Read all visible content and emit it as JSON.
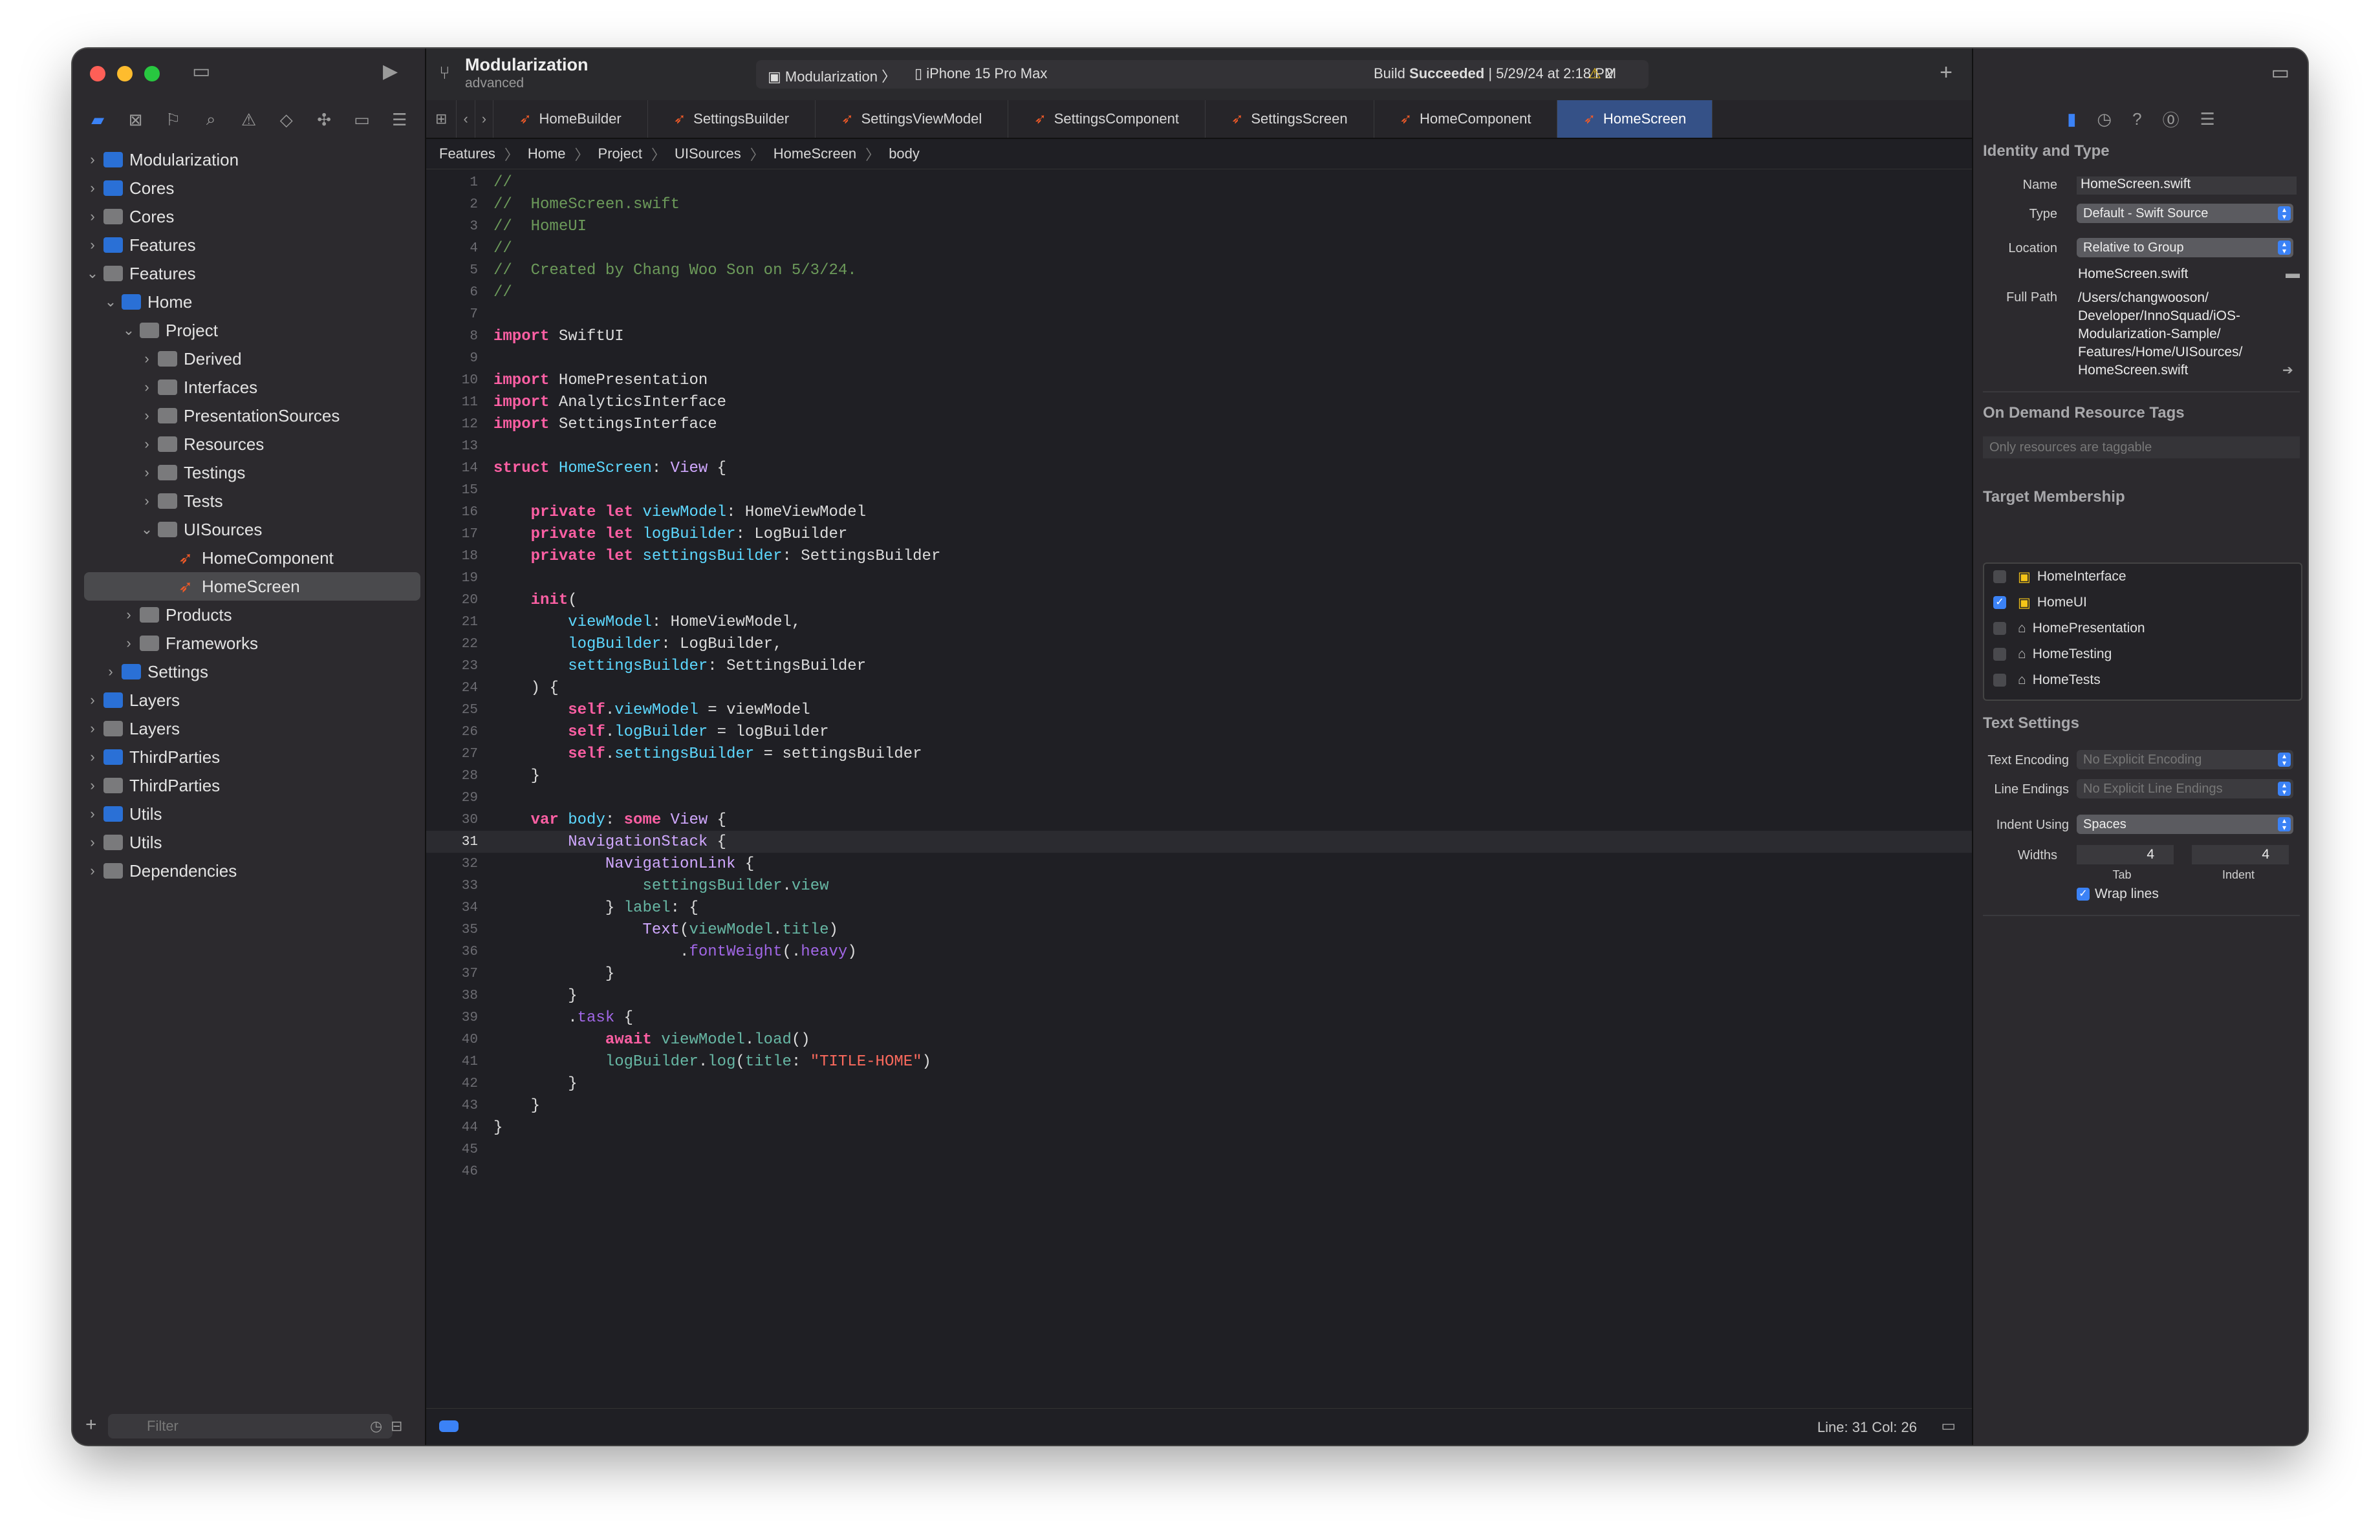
{
  "toolbar": {
    "project": "Modularization",
    "branch": "advanced",
    "scheme": "Modularization",
    "device": "iPhone 15 Pro Max",
    "build_status_prefix": "Build ",
    "build_status_bold": "Succeeded",
    "build_status_suffix": " | 5/29/24 at 2:18 PM",
    "warning_count": "2"
  },
  "navigator": {
    "items": [
      {
        "label": "Modularization",
        "depth": 0,
        "chevron": "›",
        "kind": "proj"
      },
      {
        "label": "Cores",
        "depth": 0,
        "chevron": "›",
        "kind": "proj"
      },
      {
        "label": "Cores",
        "depth": 0,
        "chevron": "›",
        "kind": "fold"
      },
      {
        "label": "Features",
        "depth": 0,
        "chevron": "›",
        "kind": "proj"
      },
      {
        "label": "Features",
        "depth": 0,
        "chevron": "⌄",
        "kind": "fold"
      },
      {
        "label": "Home",
        "depth": 1,
        "chevron": "⌄",
        "kind": "proj"
      },
      {
        "label": "Project",
        "depth": 2,
        "chevron": "⌄",
        "kind": "fold"
      },
      {
        "label": "Derived",
        "depth": 3,
        "chevron": "›",
        "kind": "fold"
      },
      {
        "label": "Interfaces",
        "depth": 3,
        "chevron": "›",
        "kind": "fold"
      },
      {
        "label": "PresentationSources",
        "depth": 3,
        "chevron": "›",
        "kind": "fold"
      },
      {
        "label": "Resources",
        "depth": 3,
        "chevron": "›",
        "kind": "fold"
      },
      {
        "label": "Testings",
        "depth": 3,
        "chevron": "›",
        "kind": "fold"
      },
      {
        "label": "Tests",
        "depth": 3,
        "chevron": "›",
        "kind": "fold"
      },
      {
        "label": "UISources",
        "depth": 3,
        "chevron": "⌄",
        "kind": "fold"
      },
      {
        "label": "HomeComponent",
        "depth": 4,
        "chevron": "",
        "kind": "swift"
      },
      {
        "label": "HomeScreen",
        "depth": 4,
        "chevron": "",
        "kind": "swift",
        "selected": true
      },
      {
        "label": "Products",
        "depth": 2,
        "chevron": "›",
        "kind": "fold"
      },
      {
        "label": "Frameworks",
        "depth": 2,
        "chevron": "›",
        "kind": "fold"
      },
      {
        "label": "Settings",
        "depth": 1,
        "chevron": "›",
        "kind": "proj"
      },
      {
        "label": "Layers",
        "depth": 0,
        "chevron": "›",
        "kind": "proj"
      },
      {
        "label": "Layers",
        "depth": 0,
        "chevron": "›",
        "kind": "fold"
      },
      {
        "label": "ThirdParties",
        "depth": 0,
        "chevron": "›",
        "kind": "proj"
      },
      {
        "label": "ThirdParties",
        "depth": 0,
        "chevron": "›",
        "kind": "fold"
      },
      {
        "label": "Utils",
        "depth": 0,
        "chevron": "›",
        "kind": "proj"
      },
      {
        "label": "Utils",
        "depth": 0,
        "chevron": "›",
        "kind": "fold"
      },
      {
        "label": "Dependencies",
        "depth": 0,
        "chevron": "›",
        "kind": "fold"
      }
    ],
    "filter_placeholder": "Filter"
  },
  "tabs": [
    "HomeBuilder",
    "SettingsBuilder",
    "SettingsViewModel",
    "SettingsComponent",
    "SettingsScreen",
    "HomeComponent",
    "HomeScreen"
  ],
  "active_tab": "HomeScreen",
  "breadcrumb": [
    "Features",
    "Home",
    "Project",
    "UISources",
    "HomeScreen",
    "body"
  ],
  "code_lines": [
    [
      [
        "c",
        "//"
      ]
    ],
    [
      [
        "c",
        "//  HomeScreen.swift"
      ]
    ],
    [
      [
        "c",
        "//  HomeUI"
      ]
    ],
    [
      [
        "c",
        "//"
      ]
    ],
    [
      [
        "c",
        "//  Created by Chang Woo Son on 5/3/24."
      ]
    ],
    [
      [
        "c",
        "//"
      ]
    ],
    [],
    [
      [
        "k",
        "import"
      ],
      [
        "p",
        " SwiftUI"
      ]
    ],
    [],
    [
      [
        "k",
        "import"
      ],
      [
        "p",
        " HomePresentation"
      ]
    ],
    [
      [
        "k",
        "import"
      ],
      [
        "p",
        " AnalyticsInterface"
      ]
    ],
    [
      [
        "k",
        "import"
      ],
      [
        "p",
        " SettingsInterface"
      ]
    ],
    [],
    [
      [
        "k",
        "struct"
      ],
      [
        "p",
        " "
      ],
      [
        "d",
        "HomeScreen"
      ],
      [
        "p",
        ": "
      ],
      [
        "t",
        "View"
      ],
      [
        "p",
        " {"
      ]
    ],
    [],
    [
      [
        "p",
        "    "
      ],
      [
        "k",
        "private let"
      ],
      [
        "p",
        " "
      ],
      [
        "d",
        "viewModel"
      ],
      [
        "p",
        ": HomeViewModel"
      ]
    ],
    [
      [
        "p",
        "    "
      ],
      [
        "k",
        "private let"
      ],
      [
        "p",
        " "
      ],
      [
        "d",
        "logBuilder"
      ],
      [
        "p",
        ": LogBuilder"
      ]
    ],
    [
      [
        "p",
        "    "
      ],
      [
        "k",
        "private let"
      ],
      [
        "p",
        " "
      ],
      [
        "d",
        "settingsBuilder"
      ],
      [
        "p",
        ": SettingsBuilder"
      ]
    ],
    [],
    [
      [
        "p",
        "    "
      ],
      [
        "k",
        "init"
      ],
      [
        "p",
        "("
      ]
    ],
    [
      [
        "p",
        "        "
      ],
      [
        "d",
        "viewModel"
      ],
      [
        "p",
        ": HomeViewModel,"
      ]
    ],
    [
      [
        "p",
        "        "
      ],
      [
        "d",
        "logBuilder"
      ],
      [
        "p",
        ": LogBuilder,"
      ]
    ],
    [
      [
        "p",
        "        "
      ],
      [
        "d",
        "settingsBuilder"
      ],
      [
        "p",
        ": SettingsBuilder"
      ]
    ],
    [
      [
        "p",
        "    ) {"
      ]
    ],
    [
      [
        "p",
        "        "
      ],
      [
        "k",
        "self"
      ],
      [
        "p",
        "."
      ],
      [
        "d",
        "viewModel"
      ],
      [
        "p",
        " = viewModel"
      ]
    ],
    [
      [
        "p",
        "        "
      ],
      [
        "k",
        "self"
      ],
      [
        "p",
        "."
      ],
      [
        "d",
        "logBuilder"
      ],
      [
        "p",
        " = logBuilder"
      ]
    ],
    [
      [
        "p",
        "        "
      ],
      [
        "k",
        "self"
      ],
      [
        "p",
        "."
      ],
      [
        "d",
        "settingsBuilder"
      ],
      [
        "p",
        " = settingsBuilder"
      ]
    ],
    [
      [
        "p",
        "    }"
      ]
    ],
    [],
    [
      [
        "p",
        "    "
      ],
      [
        "k",
        "var"
      ],
      [
        "p",
        " "
      ],
      [
        "d",
        "body"
      ],
      [
        "p",
        ": "
      ],
      [
        "k",
        "some"
      ],
      [
        "p",
        " "
      ],
      [
        "t",
        "View"
      ],
      [
        "p",
        " {"
      ]
    ],
    [
      [
        "p",
        "        "
      ],
      [
        "t",
        "NavigationStack"
      ],
      [
        "p",
        " {"
      ]
    ],
    [
      [
        "p",
        "            "
      ],
      [
        "t",
        "NavigationLink"
      ],
      [
        "p",
        " {"
      ]
    ],
    [
      [
        "p",
        "                "
      ],
      [
        "f",
        "settingsBuilder"
      ],
      [
        "p",
        "."
      ],
      [
        "f",
        "view"
      ]
    ],
    [
      [
        "p",
        "            } "
      ],
      [
        "f",
        "label"
      ],
      [
        "p",
        ": {"
      ]
    ],
    [
      [
        "p",
        "                "
      ],
      [
        "t",
        "Text"
      ],
      [
        "p",
        "("
      ],
      [
        "f",
        "viewModel"
      ],
      [
        "p",
        "."
      ],
      [
        "f",
        "title"
      ],
      [
        "p",
        ")"
      ]
    ],
    [
      [
        "p",
        "                    ."
      ],
      [
        "m",
        "fontWeight"
      ],
      [
        "p",
        "(."
      ],
      [
        "m",
        "heavy"
      ],
      [
        "p",
        ")"
      ]
    ],
    [
      [
        "p",
        "            }"
      ]
    ],
    [
      [
        "p",
        "        }"
      ]
    ],
    [
      [
        "p",
        "        ."
      ],
      [
        "m",
        "task"
      ],
      [
        "p",
        " {"
      ]
    ],
    [
      [
        "p",
        "            "
      ],
      [
        "k",
        "await"
      ],
      [
        "p",
        " "
      ],
      [
        "f",
        "viewModel"
      ],
      [
        "p",
        "."
      ],
      [
        "f",
        "load"
      ],
      [
        "p",
        "()"
      ]
    ],
    [
      [
        "p",
        "            "
      ],
      [
        "f",
        "logBuilder"
      ],
      [
        "p",
        "."
      ],
      [
        "f",
        "log"
      ],
      [
        "p",
        "("
      ],
      [
        "f",
        "title"
      ],
      [
        "p",
        ": "
      ],
      [
        "s",
        "\"TITLE-HOME\""
      ],
      [
        "p",
        ")"
      ]
    ],
    [
      [
        "p",
        "        }"
      ]
    ],
    [
      [
        "p",
        "    }"
      ]
    ],
    [
      [
        "p",
        "}"
      ]
    ],
    [],
    []
  ],
  "current_line": 31,
  "status": {
    "position": "Line: 31  Col: 26"
  },
  "inspector": {
    "identity_title": "Identity and Type",
    "name_label": "Name",
    "name_value": "HomeScreen.swift",
    "type_label": "Type",
    "type_value": "Default - Swift Source",
    "location_label": "Location",
    "location_value": "Relative to Group",
    "location_file": "HomeScreen.swift",
    "fullpath_label": "Full Path",
    "fullpath_lines": [
      "/Users/changwooson/",
      "Developer/InnoSquad/iOS-",
      "Modularization-Sample/",
      "Features/Home/UISources/",
      "HomeScreen.swift"
    ],
    "odr_title": "On Demand Resource Tags",
    "odr_placeholder": "Only resources are taggable",
    "tm_title": "Target Membership",
    "targets": [
      {
        "name": "HomeInterface",
        "checked": false
      },
      {
        "name": "HomeUI",
        "checked": true
      },
      {
        "name": "HomePresentation",
        "checked": false
      },
      {
        "name": "HomeTesting",
        "checked": false
      },
      {
        "name": "HomeTests",
        "checked": false
      }
    ],
    "text_title": "Text Settings",
    "encoding_label": "Text Encoding",
    "encoding_value": "No Explicit Encoding",
    "endings_label": "Line Endings",
    "endings_value": "No Explicit Line Endings",
    "indent_label": "Indent Using",
    "indent_value": "Spaces",
    "widths_label": "Widths",
    "tab_width": "4",
    "indent_width": "4",
    "tab_caption": "Tab",
    "indent_caption": "Indent",
    "wrap_label": "Wrap lines"
  },
  "colors": {
    "keyword": "#fc5fa3",
    "comment": "#6c9a5a",
    "type": "#d0a8ff",
    "decl": "#5dd8ff",
    "field": "#67b7a4",
    "method": "#a167e6",
    "string": "#fc6a5d",
    "accent": "#3b82f6"
  }
}
